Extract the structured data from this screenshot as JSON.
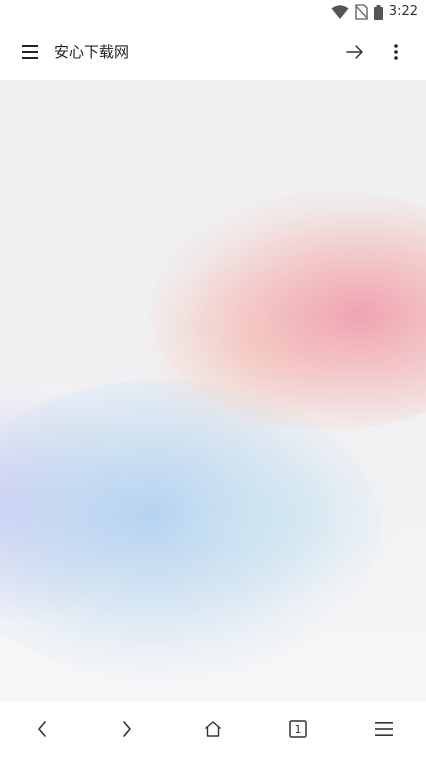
{
  "status_bar": {
    "time": "3:22",
    "icons": [
      "wifi-icon",
      "no-sim-icon",
      "battery-icon"
    ]
  },
  "app_bar": {
    "title": "安心下载网",
    "icons": [
      "hamburger-menu-icon",
      "arrow-forward-icon",
      "more-vert-icon"
    ]
  },
  "bottom_nav": {
    "tab_count": "1",
    "icons": [
      "chevron-left-icon",
      "chevron-right-icon",
      "home-icon",
      "tabs-icon",
      "menu-icon"
    ]
  },
  "colors": {
    "background": "#ffffff",
    "icon": "#333333",
    "warm_glow": "#f0a0b0",
    "cool_glow": "#b4d4f0",
    "violet_glow": "#cdc3f5"
  }
}
